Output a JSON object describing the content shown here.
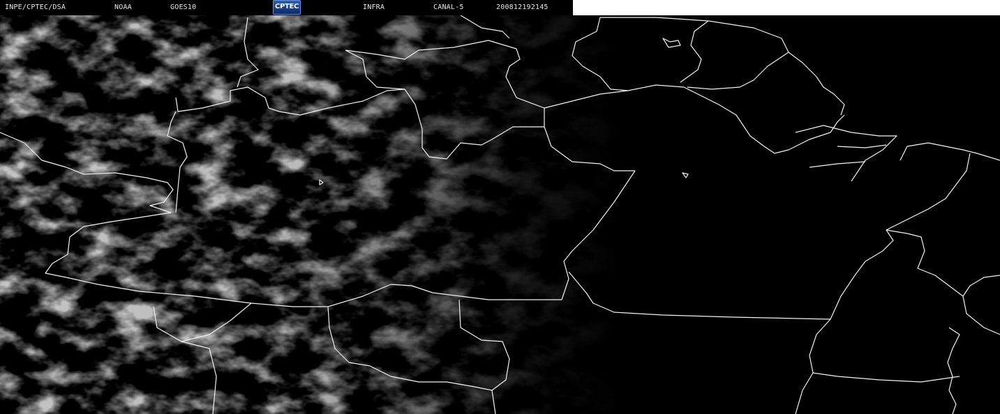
{
  "header": {
    "agency": "INPE/CPTEC/DSA",
    "operator": "NOAA",
    "satellite": "GOES10",
    "logo_text": "CPTEC",
    "product": "INFRA",
    "channel": "CANAL-5",
    "timestamp": "200812192145"
  },
  "colors": {
    "background": "#000000",
    "border_lines": "#f2f2f2",
    "cloud_gray": "#8a8a8a",
    "header_text": "#e6e6e6",
    "logo_blue": "#1b3e86"
  }
}
